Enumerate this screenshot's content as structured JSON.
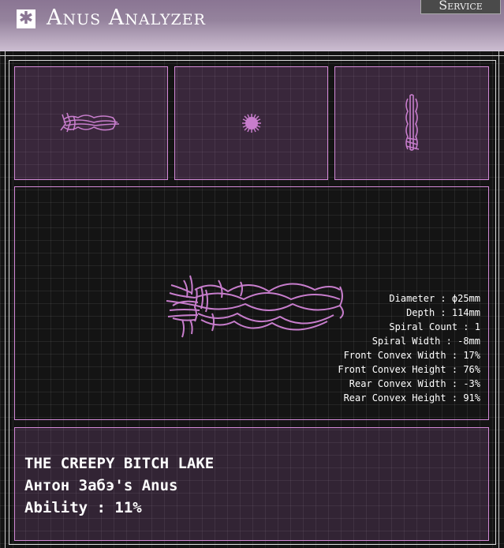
{
  "app": {
    "title": "Anus Analyzer",
    "logo_icon": "asterisk-icon",
    "service_label": "Service"
  },
  "colors": {
    "accent": "#c77dcc",
    "header_top": "#8a7593",
    "header_bottom": "#cbbcd0",
    "panel_border": "#d48ad8"
  },
  "specs": [
    {
      "label": "Diameter",
      "value": "ϕ25mm"
    },
    {
      "label": "Depth",
      "value": "114mm"
    },
    {
      "label": "Spiral Count",
      "value": "1"
    },
    {
      "label": "Spiral Width",
      "value": "-8mm"
    },
    {
      "label": "Front Convex Width",
      "value": "17%"
    },
    {
      "label": "Front Convex Height",
      "value": "76%"
    },
    {
      "label": "Rear Convex Width",
      "value": "-3%"
    },
    {
      "label": "Rear Convex Height",
      "value": "91%"
    }
  ],
  "info": {
    "location": "THE CREEPY BITCH LAKE",
    "owner": "Антон Забэ's Anus",
    "ability": "Ability : 11%"
  }
}
